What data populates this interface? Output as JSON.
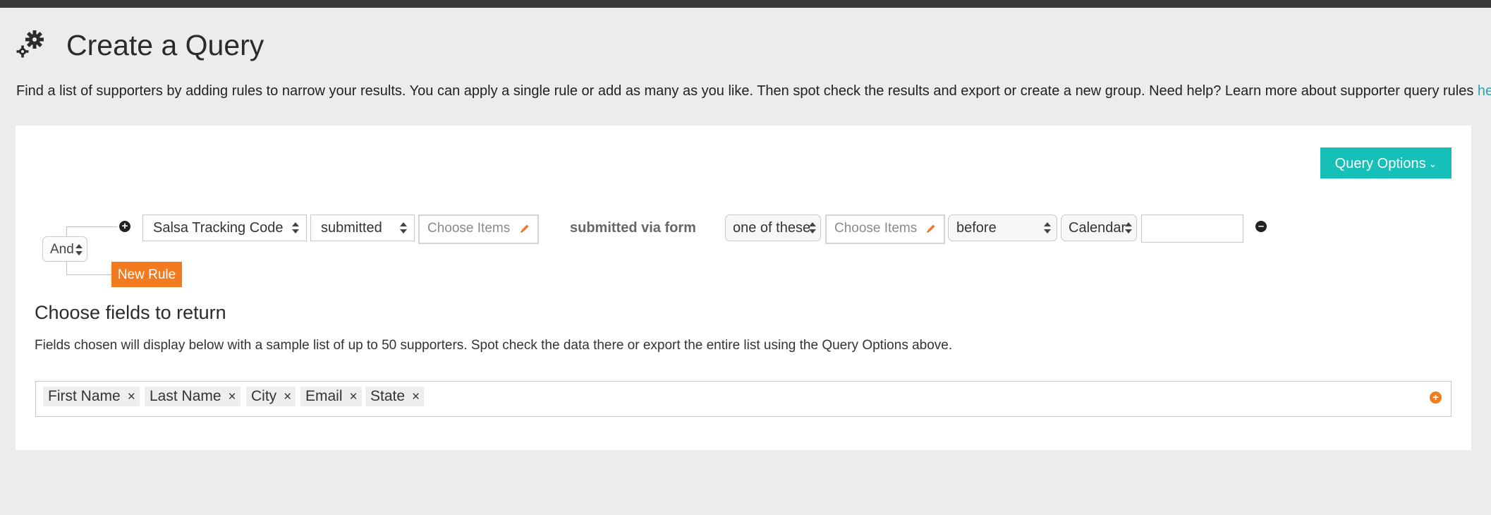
{
  "header": {
    "title": "Create a Query",
    "icon": "gears-icon",
    "intro_text": "Find a list of supporters by adding rules to narrow your results. You can apply a single rule or add as many as you like. Then spot check the results and export or create a new group. Need help? Learn more about supporter query rules ",
    "intro_link": "here",
    "intro_end": "."
  },
  "toolbar": {
    "query_options_label": "Query Options"
  },
  "rules": {
    "group_operator": "And",
    "new_rule_label": "New Rule",
    "rule": {
      "field": "Salsa Tracking Code",
      "condition": "submitted",
      "items_placeholder": "Choose Items",
      "via_text": "submitted via form",
      "match": "one of these",
      "form_items_placeholder": "Choose Items",
      "time_operator": "before",
      "date_mode": "Calendar",
      "date_value": ""
    }
  },
  "fields": {
    "title": "Choose fields to return",
    "description": "Fields chosen will display below with a sample list of up to 50 supporters. Spot check the data there or export the entire list using the Query Options above.",
    "chips": [
      {
        "label": "First Name"
      },
      {
        "label": "Last Name"
      },
      {
        "label": "City"
      },
      {
        "label": "Email"
      },
      {
        "label": "State"
      }
    ],
    "remove_glyph": "×"
  },
  "colors": {
    "accent_teal": "#16bfb8",
    "accent_orange": "#f47a20",
    "link": "#1fa9b4",
    "topbar": "#3a3a3a",
    "background": "#ececec"
  }
}
